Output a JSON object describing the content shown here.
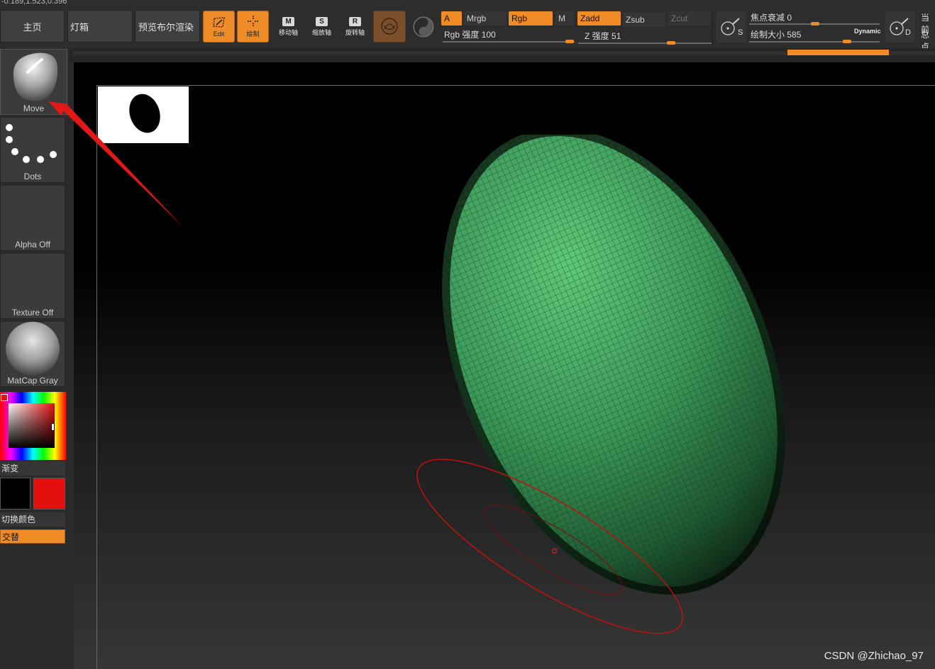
{
  "header": {
    "coords": "-0.189,1.523,0.396"
  },
  "nav": {
    "home": "主页",
    "lightbox": "灯箱",
    "bpr": "预览布尔渲染"
  },
  "tools": {
    "edit": {
      "label": "Edit"
    },
    "draw": {
      "label": "绘制"
    },
    "move": {
      "key": "M",
      "label": "移动轴"
    },
    "scale": {
      "key": "S",
      "label": "缩放轴"
    },
    "rotate": {
      "key": "R",
      "label": "旋转轴"
    }
  },
  "color_modes": {
    "a": "A",
    "mrgb": "Mrgb",
    "rgb": "Rgb",
    "m": "M"
  },
  "rgb_intensity": {
    "label": "Rgb 强度",
    "value": 100
  },
  "z_modes": {
    "zadd": "Zadd",
    "zsub": "Zsub",
    "zcut": "Zcut"
  },
  "z_intensity": {
    "label": "Z 强度",
    "value": 51
  },
  "s_button": {
    "letter": "S"
  },
  "d_button": {
    "letter": "D"
  },
  "focal_shift": {
    "label": "焦点衰减",
    "value": 0
  },
  "draw_size": {
    "label": "绘制大小",
    "value": 585,
    "dynamic": "Dynamic"
  },
  "right_cut": {
    "line1": "当前",
    "line2": "总点"
  },
  "shelf": {
    "brush": "Move",
    "stroke": "Dots",
    "alpha": "Alpha Off",
    "texture": "Texture Off",
    "material": "MatCap Gray",
    "gradient": "渐变",
    "switch_color": "切换颜色",
    "alternate": "交替"
  },
  "colors": {
    "main": "#000000",
    "secondary": "#e41010",
    "accent": "#f08c28",
    "mesh": "#3f9f5f"
  },
  "watermark": "CSDN @Zhichao_97"
}
